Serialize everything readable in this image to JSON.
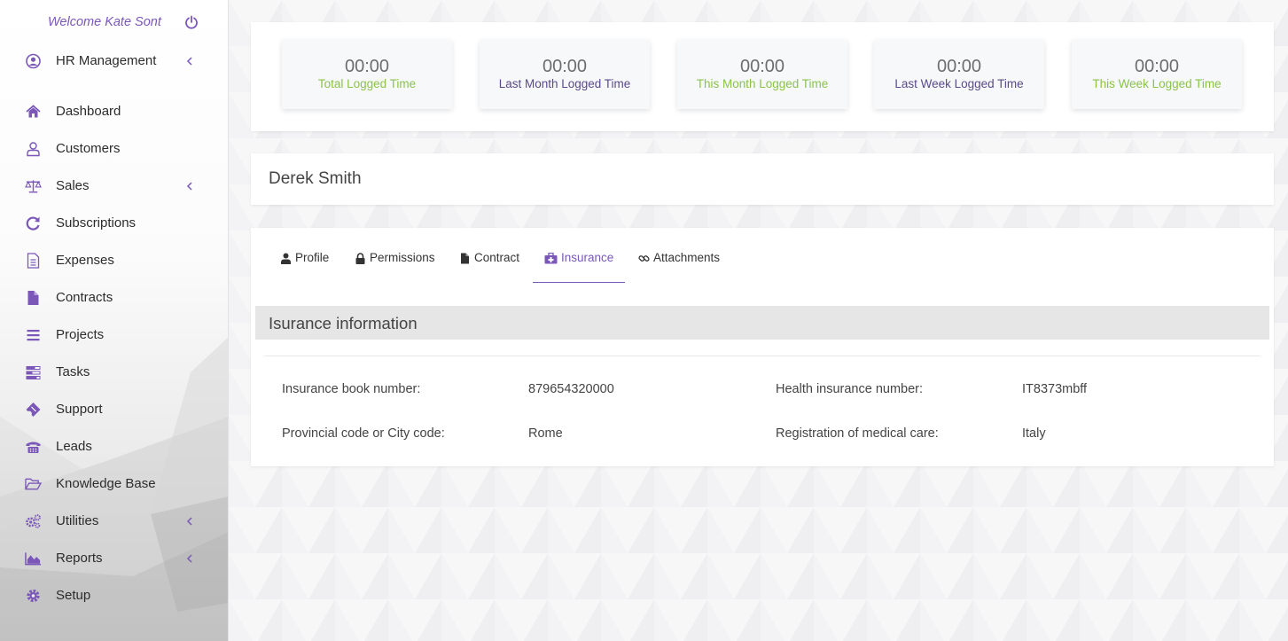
{
  "colors": {
    "accent": "#7a57b8",
    "green": "#8bc34a",
    "purple_text": "#5a4a8a",
    "section_bg": "#e6e6e6"
  },
  "sidebar": {
    "welcome": "Welcome Kate Sont",
    "logout_icon": "power-icon",
    "items": [
      {
        "label": "HR Management",
        "icon": "user-circle-icon",
        "has_submenu": true
      },
      {
        "label": "Dashboard",
        "icon": "home-icon",
        "has_submenu": false
      },
      {
        "label": "Customers",
        "icon": "user-icon",
        "has_submenu": false
      },
      {
        "label": "Sales",
        "icon": "balance-scale-icon",
        "has_submenu": true
      },
      {
        "label": "Subscriptions",
        "icon": "refresh-icon",
        "has_submenu": false
      },
      {
        "label": "Expenses",
        "icon": "file-text-icon",
        "has_submenu": false
      },
      {
        "label": "Contracts",
        "icon": "file-icon",
        "has_submenu": false
      },
      {
        "label": "Projects",
        "icon": "bars-icon",
        "has_submenu": false
      },
      {
        "label": "Tasks",
        "icon": "tasks-icon",
        "has_submenu": false
      },
      {
        "label": "Support",
        "icon": "ticket-icon",
        "has_submenu": false
      },
      {
        "label": "Leads",
        "icon": "phone-icon",
        "has_submenu": false
      },
      {
        "label": "Knowledge Base",
        "icon": "folder-open-icon",
        "has_submenu": false
      },
      {
        "label": "Utilities",
        "icon": "cogs-icon",
        "has_submenu": true
      },
      {
        "label": "Reports",
        "icon": "area-chart-icon",
        "has_submenu": true
      },
      {
        "label": "Setup",
        "icon": "cog-icon",
        "has_submenu": false
      }
    ]
  },
  "stats": [
    {
      "value": "00:00",
      "label": "Total Logged Time",
      "color": "green"
    },
    {
      "value": "00:00",
      "label": "Last Month Logged Time",
      "color": "purple"
    },
    {
      "value": "00:00",
      "label": "This Month Logged Time",
      "color": "green"
    },
    {
      "value": "00:00",
      "label": "Last Week Logged Time",
      "color": "purple"
    },
    {
      "value": "00:00",
      "label": "This Week Logged Time",
      "color": "green"
    }
  ],
  "employee": {
    "name": "Derek Smith"
  },
  "tabs": [
    {
      "label": "Profile",
      "icon": "user-icon",
      "active": false
    },
    {
      "label": "Permissions",
      "icon": "lock-icon",
      "active": false
    },
    {
      "label": "Contract",
      "icon": "file-icon",
      "active": false
    },
    {
      "label": "Insurance",
      "icon": "medkit-icon",
      "active": true
    },
    {
      "label": "Attachments",
      "icon": "link-icon",
      "active": false
    }
  ],
  "insurance": {
    "title": "Isurance information",
    "fields": [
      {
        "label": "Insurance book number:",
        "value": "879654320000"
      },
      {
        "label": "Health insurance number:",
        "value": "IT8373mbff"
      },
      {
        "label": "Provincial code or City code:",
        "value": "Rome"
      },
      {
        "label": "Registration of medical care:",
        "value": "Italy"
      }
    ]
  }
}
